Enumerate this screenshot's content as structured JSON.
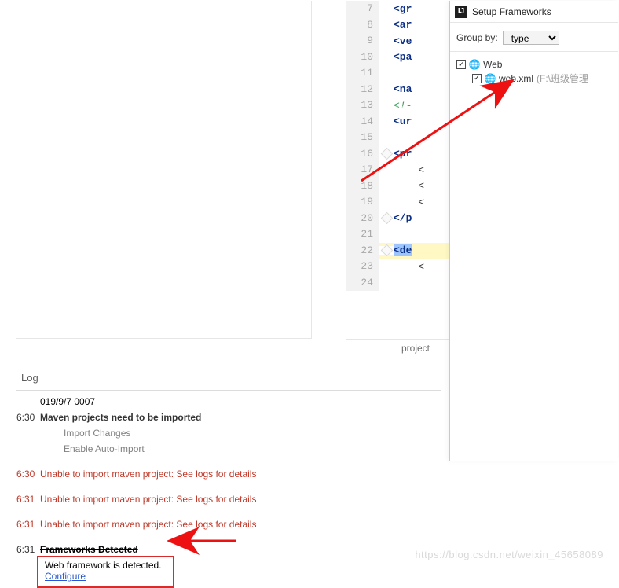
{
  "editor": {
    "lines": [
      {
        "n": 7,
        "fold": "",
        "seg": [
          {
            "cls": "tag",
            "t": "<gr"
          }
        ]
      },
      {
        "n": 8,
        "fold": "",
        "seg": [
          {
            "cls": "tag",
            "t": "<ar"
          }
        ]
      },
      {
        "n": 9,
        "fold": "",
        "seg": [
          {
            "cls": "tag",
            "t": "<ve"
          }
        ]
      },
      {
        "n": 10,
        "fold": "",
        "seg": [
          {
            "cls": "tag",
            "t": "<pa"
          }
        ]
      },
      {
        "n": 11,
        "fold": "",
        "seg": []
      },
      {
        "n": 12,
        "fold": "",
        "seg": [
          {
            "cls": "tag",
            "t": "<na"
          }
        ]
      },
      {
        "n": 13,
        "fold": "",
        "seg": [
          {
            "cls": "cmt",
            "t": "<!-"
          }
        ]
      },
      {
        "n": 14,
        "fold": "",
        "seg": [
          {
            "cls": "tag",
            "t": "<ur"
          }
        ]
      },
      {
        "n": 15,
        "fold": "",
        "seg": []
      },
      {
        "n": 16,
        "fold": "open",
        "seg": [
          {
            "cls": "tag",
            "t": "<pr"
          }
        ]
      },
      {
        "n": 17,
        "fold": "line",
        "seg": [
          {
            "cls": "",
            "t": "    <"
          }
        ]
      },
      {
        "n": 18,
        "fold": "line",
        "seg": [
          {
            "cls": "",
            "t": "    <"
          }
        ]
      },
      {
        "n": 19,
        "fold": "line",
        "seg": [
          {
            "cls": "",
            "t": "    <"
          }
        ]
      },
      {
        "n": 20,
        "fold": "close",
        "seg": [
          {
            "cls": "tag",
            "t": "</p"
          }
        ]
      },
      {
        "n": 21,
        "fold": "",
        "seg": []
      },
      {
        "n": 22,
        "fold": "open",
        "hl": true,
        "seg": [
          {
            "cls": "tag sel",
            "t": "<de"
          }
        ]
      },
      {
        "n": 23,
        "fold": "line",
        "seg": [
          {
            "cls": "",
            "t": "    <"
          }
        ]
      },
      {
        "n": 24,
        "fold": "",
        "seg": []
      }
    ],
    "breadcrumb": "project"
  },
  "log": {
    "title": "Log",
    "date": "019/9/7 0007",
    "entries": [
      {
        "time": "6:30",
        "msg": "Maven projects need to be imported",
        "type": "head"
      },
      {
        "time": "",
        "msg": "Import Changes",
        "type": "sub"
      },
      {
        "time": "",
        "msg": "Enable Auto-Import",
        "type": "sub"
      },
      {
        "time": "6:30",
        "msg": "Unable to import maven project: See logs for details",
        "type": "err"
      },
      {
        "time": "6:31",
        "msg": "Unable to import maven project: See logs for details",
        "type": "err"
      },
      {
        "time": "6:31",
        "msg": "Unable to import maven project: See logs for details",
        "type": "err"
      },
      {
        "time": "6:31",
        "msg": "Frameworks Detected",
        "type": "strike"
      }
    ],
    "notif": {
      "msg": "Web framework is detected.",
      "action": "Configure"
    }
  },
  "dialog": {
    "title": "Setup Frameworks",
    "group_label": "Group by:",
    "group_value": "type",
    "tree": {
      "root_label": "Web",
      "root_checked": true,
      "child_label": "web.xml",
      "child_path": "(F:\\班级管理",
      "child_checked": true
    }
  },
  "watermark": "https://blog.csdn.net/weixin_45658089"
}
